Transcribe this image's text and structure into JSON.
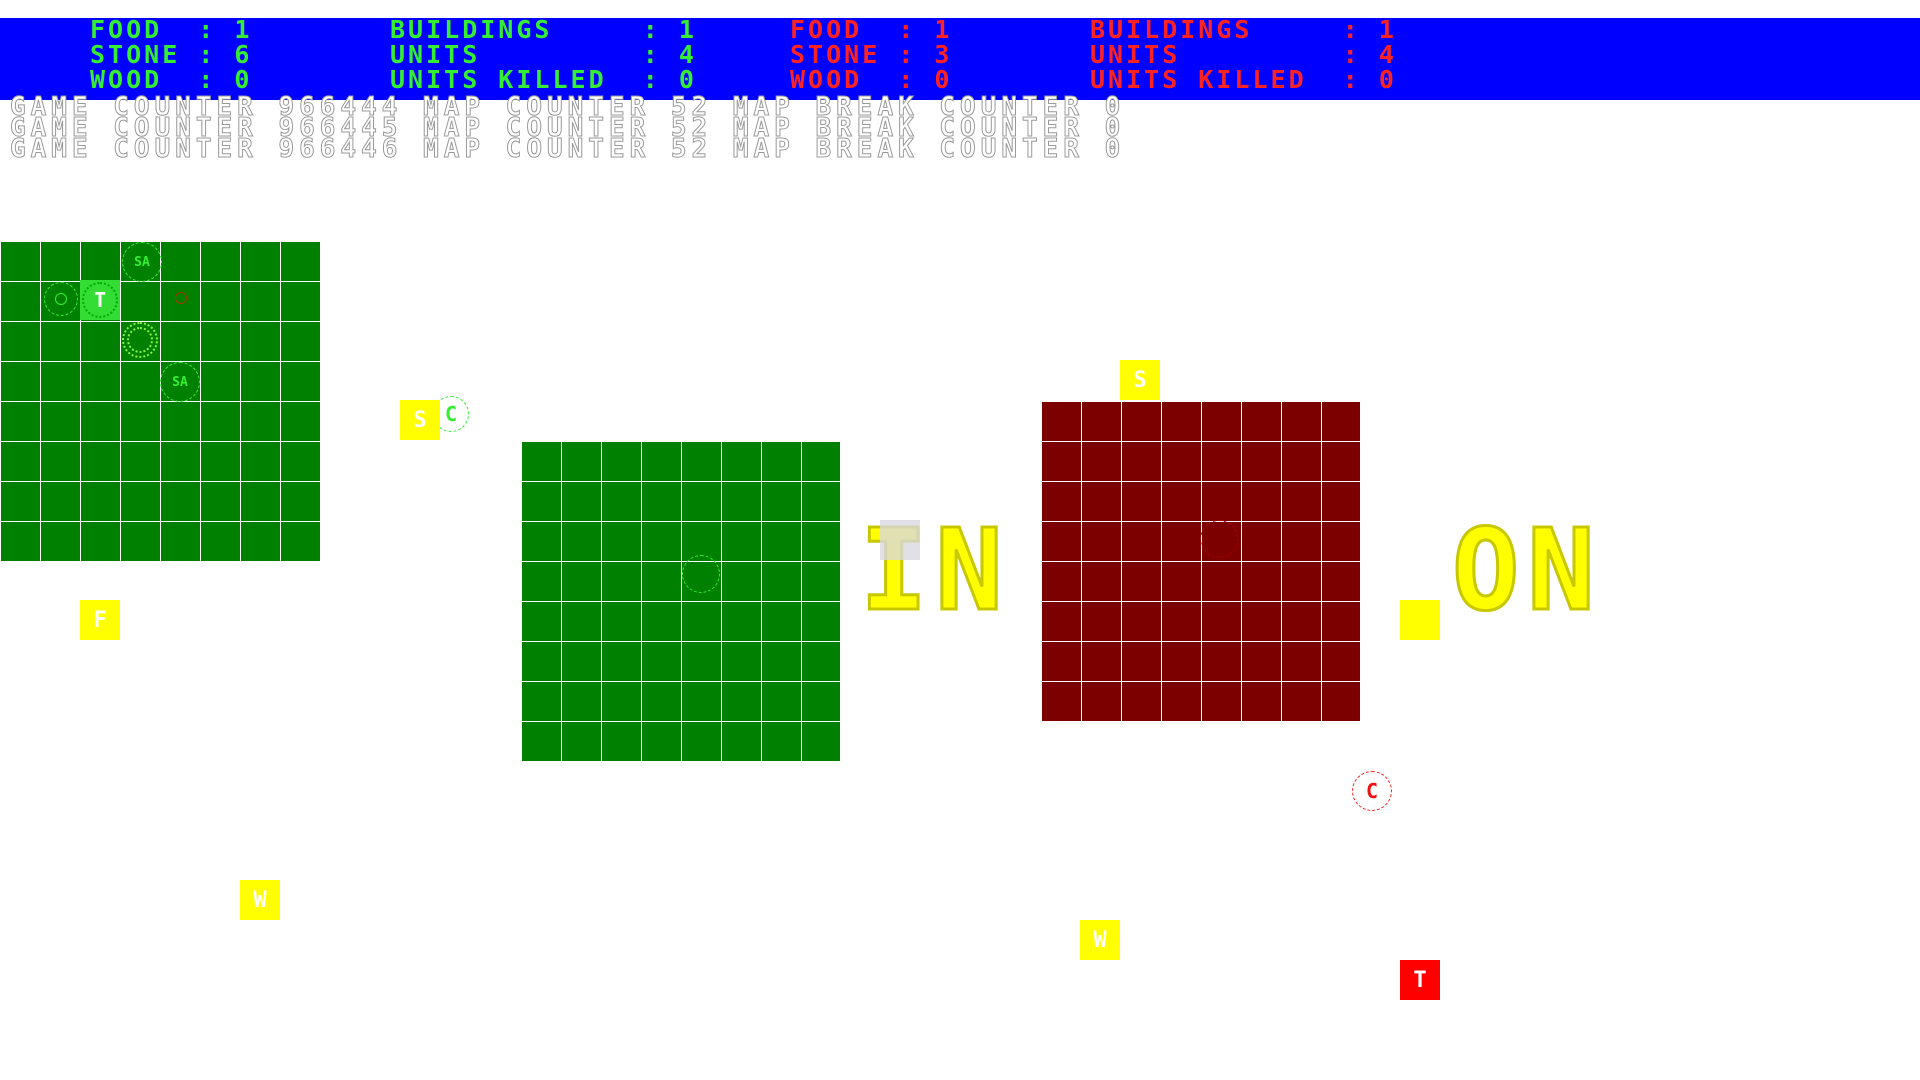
{
  "hud": {
    "player1": {
      "food_line": "FOOD  : 1",
      "stone_line": "STONE : 6",
      "wood_line": "WOOD  : 0",
      "buildings_line": "BUILDINGS     : 1",
      "units_line": "UNITS         : 4",
      "killed_line": "UNITS KILLED  : 0"
    },
    "player2": {
      "food_line": "FOOD  : 1",
      "stone_line": "STONE : 3",
      "wood_line": "WOOD  : 0",
      "buildings_line": "BUILDINGS     : 1",
      "units_line": "UNITS         : 4",
      "killed_line": "UNITS KILLED  : 0"
    },
    "colors": {
      "bar": "#0000ff",
      "player1": "#33ee33",
      "player2": "#ff2222"
    }
  },
  "counters": [
    "GAME COUNTER 966444 MAP COUNTER 52 MAP BREAK COUNTER 0",
    "GAME COUNTER 966445 MAP COUNTER 52 MAP BREAK COUNTER 0",
    "GAME COUNTER 966446 MAP COUNTER 52 MAP BREAK COUNTER 0"
  ],
  "background_text": {
    "left": "IN",
    "right": "ON"
  },
  "resources": {
    "stone_a": "S",
    "stone_b": "S",
    "food": "F",
    "wood_a": "W",
    "wood_b": "W",
    "stone_right": ""
  },
  "units": {
    "green_sa_1": "SA",
    "green_sa_2": "SA",
    "green_town": "T",
    "green_center": "C",
    "red_center": "C",
    "red_town": "T"
  },
  "colors": {
    "green_territory": "#008000",
    "red_territory": "#7d0000",
    "resource": "#ffff00",
    "grid_line": "#ffffff"
  }
}
